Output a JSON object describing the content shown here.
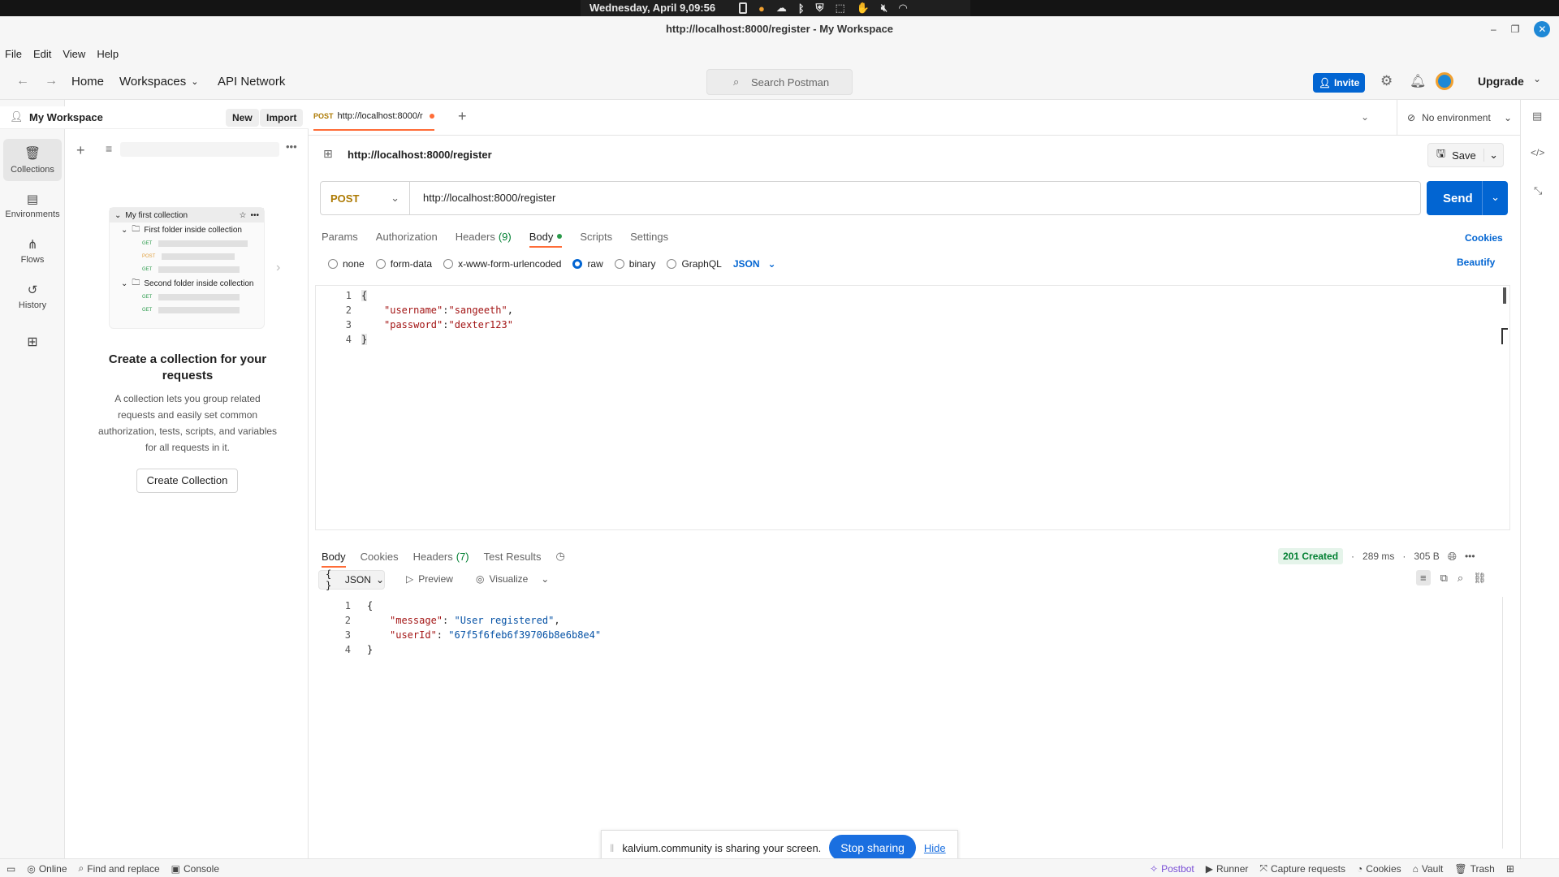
{
  "system": {
    "datetime": "Wednesday, April  9,09:56"
  },
  "window": {
    "title": "http://localhost:8000/register - My Workspace"
  },
  "menu": [
    "File",
    "Edit",
    "View",
    "Help"
  ],
  "header": {
    "home": "Home",
    "workspaces": "Workspaces",
    "api_network": "API Network",
    "search_placeholder": "Search Postman",
    "invite": "Invite",
    "upgrade": "Upgrade"
  },
  "rail": [
    {
      "label": "Collections",
      "icon": "collections-icon"
    },
    {
      "label": "Environments",
      "icon": "environments-icon"
    },
    {
      "label": "Flows",
      "icon": "flows-icon"
    },
    {
      "label": "History",
      "icon": "history-icon"
    }
  ],
  "sidebar": {
    "workspace": "My Workspace",
    "new": "New",
    "import": "Import",
    "preview": {
      "collection": "My first collection",
      "folder1": "First folder inside collection",
      "folder2": "Second folder inside collection",
      "get": "GET",
      "post": "POST"
    },
    "heading": "Create a collection for your requests",
    "description": "A collection lets you group related requests and easily set common authorization, tests, scripts, and variables for all requests in it.",
    "create_button": "Create Collection"
  },
  "request_tab": {
    "method": "POST",
    "label": "http://localhost:8000/r"
  },
  "environment": "No environment",
  "request": {
    "title": "http://localhost:8000/register",
    "save": "Save",
    "method": "POST",
    "url": "http://localhost:8000/register",
    "send": "Send",
    "tabs": [
      "Params",
      "Authorization",
      "Headers",
      "Body",
      "Scripts",
      "Settings"
    ],
    "headers_count": "(9)",
    "cookies": "Cookies",
    "body_types": [
      "none",
      "form-data",
      "x-www-form-urlencoded",
      "raw",
      "binary",
      "GraphQL"
    ],
    "selected_body_type": "raw",
    "format": "JSON",
    "beautify": "Beautify",
    "code": [
      {
        "n": "1",
        "text": "{"
      },
      {
        "n": "2",
        "key": "\"username\"",
        "sep": ":",
        "val": "\"sangeeth\"",
        "end": ","
      },
      {
        "n": "3",
        "key": "\"password\"",
        "sep": ":",
        "val": "\"dexter123\"",
        "end": ""
      },
      {
        "n": "4",
        "text": "}"
      }
    ]
  },
  "response": {
    "tabs": [
      "Body",
      "Cookies",
      "Headers",
      "Test Results"
    ],
    "headers_count": "(7)",
    "status": "201 Created",
    "time": "289 ms",
    "size": "305 B",
    "format": "JSON",
    "preview": "Preview",
    "visualize": "Visualize",
    "code": [
      {
        "n": "1",
        "text": "{"
      },
      {
        "n": "2",
        "key": "\"message\"",
        "sep": ": ",
        "val": "\"User registered\"",
        "end": ","
      },
      {
        "n": "3",
        "key": "\"userId\"",
        "sep": ": ",
        "val": "\"67f5f6feb6f39706b8e6b8e4\"",
        "end": ""
      },
      {
        "n": "4",
        "text": "}"
      }
    ]
  },
  "share": {
    "text": "kalvium.community is sharing your screen.",
    "stop": "Stop sharing",
    "hide": "Hide"
  },
  "status": {
    "online": "Online",
    "find": "Find and replace",
    "console": "Console",
    "postbot": "Postbot",
    "runner": "Runner",
    "capture": "Capture requests",
    "cookies": "Cookies",
    "vault": "Vault",
    "trash": "Trash"
  },
  "colors": {
    "accent": "#0265d2",
    "post": "#ad7a03",
    "status_ok": "#007f31",
    "send": "#0265d2"
  }
}
